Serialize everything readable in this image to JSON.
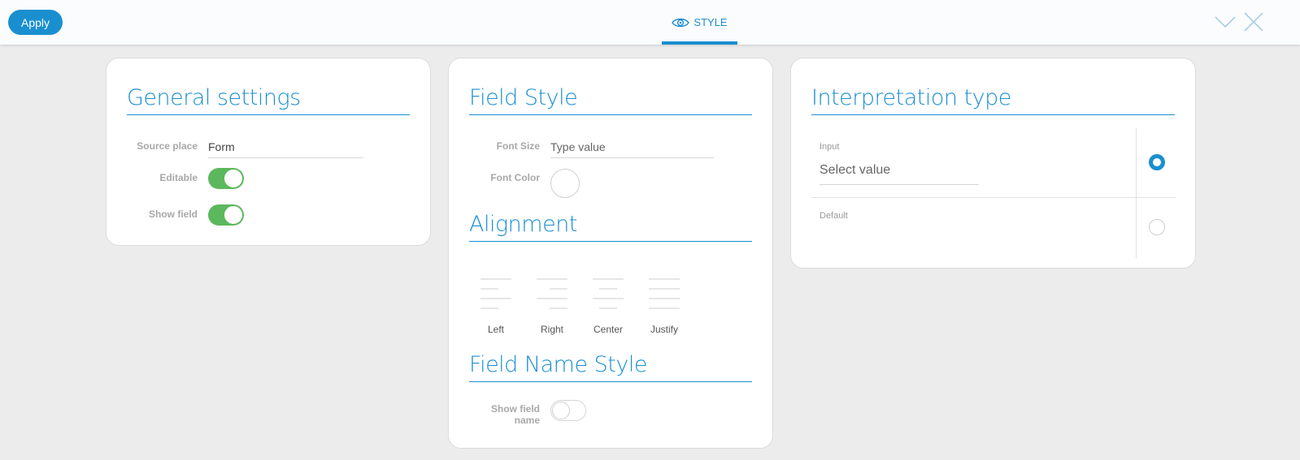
{
  "topbar": {
    "apply_label": "Apply",
    "tab_label": "STYLE"
  },
  "general": {
    "title": "General settings",
    "source_place_label": "Source place",
    "source_place_value": "Form",
    "editable_label": "Editable",
    "editable_on": true,
    "show_field_label": "Show field",
    "show_field_on": true
  },
  "field_style": {
    "title": "Field Style",
    "font_size_label": "Font Size",
    "font_size_placeholder": "Type value",
    "font_color_label": "Font Color",
    "alignment_title": "Alignment",
    "alignment_options": [
      "Left",
      "Right",
      "Center",
      "Justify"
    ],
    "field_name_style_title": "Field Name Style",
    "show_field_name_label_line1": "Show field",
    "show_field_name_label_line2": "name",
    "show_field_name_on": false
  },
  "interpretation": {
    "title": "Interpretation type",
    "input_label": "Input",
    "input_placeholder": "Select value",
    "input_selected": true,
    "default_label": "Default",
    "default_selected": false
  },
  "colors": {
    "accent": "#1a8fd0",
    "toggle_on": "#5cb85c"
  }
}
